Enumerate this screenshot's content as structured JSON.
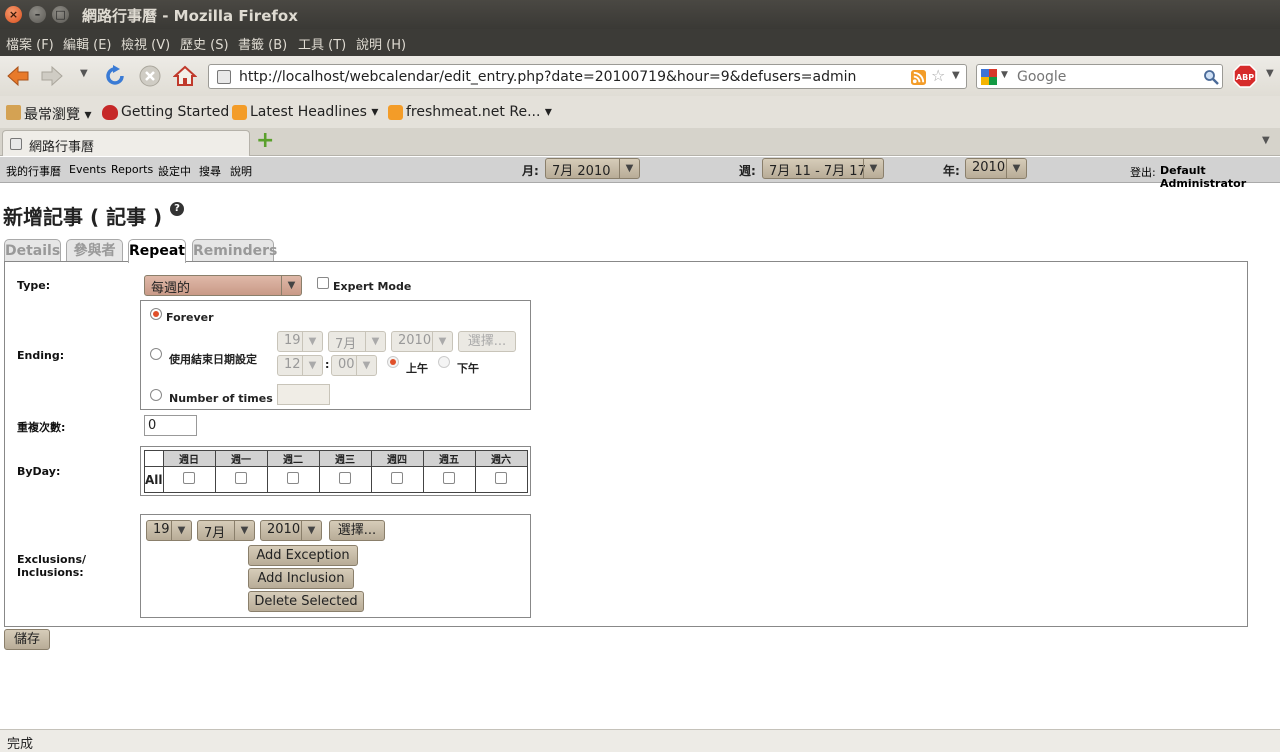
{
  "window": {
    "title": "網路行事曆 - Mozilla Firefox"
  },
  "menubar": [
    "檔案 (F)",
    "編輯 (E)",
    "檢視 (V)",
    "歷史 (S)",
    "書籤 (B)",
    "工具 (T)",
    "說明 (H)"
  ],
  "navbar": {
    "url": "http://localhost/webcalendar/edit_entry.php?date=20100719&hour=9&defusers=admin",
    "search_placeholder": "Google"
  },
  "bookmarks": [
    {
      "label": "最常瀏覽 ▾"
    },
    {
      "label": "Getting Started"
    },
    {
      "label": "Latest Headlines ▾"
    },
    {
      "label": "freshmeat.net Re... ▾"
    }
  ],
  "browser_tab": {
    "label": "網路行事曆",
    "new_tab": "+"
  },
  "topnav": {
    "links": [
      "我的行事曆",
      "Events",
      "Reports",
      "設定中",
      "搜尋",
      "說明"
    ],
    "month_label": "月:",
    "month_value": "7月 2010",
    "week_label": "週:",
    "week_value": "7月 11 - 7月 17",
    "year_label": "年:",
    "year_value": "2010",
    "logout_label": "登出:",
    "user": "Default Administrator"
  },
  "page": {
    "heading": "新增記事 ( 記事 )",
    "tabs": [
      "Details",
      "參與者",
      "Repeat",
      "Reminders"
    ],
    "active_tab": "Repeat"
  },
  "repeat": {
    "type_label": "Type:",
    "type_value": "每週的",
    "expert_mode": "Expert Mode",
    "ending_label": "Ending:",
    "forever": "Forever",
    "use_end_date": "使用結束日期設定",
    "end_day": "19",
    "end_month": "7月",
    "end_year": "2010",
    "choose": "選擇...",
    "end_hour": "12",
    "end_min": "00",
    "colon": ":",
    "am": "上午",
    "pm": "下午",
    "number_of_times": "Number of times",
    "repeat_count_label": "重複次數:",
    "repeat_count_value": "0",
    "byday_label": "ByDay:",
    "byday_days": [
      "週日",
      "週一",
      "週二",
      "週三",
      "週四",
      "週五",
      "週六"
    ],
    "byday_all": "All",
    "exclusions_label_1": "Exclusions/",
    "exclusions_label_2": "Inclusions:",
    "ex_day": "19",
    "ex_month": "7月",
    "ex_year": "2010",
    "ex_choose": "選擇...",
    "add_exception": "Add Exception",
    "add_inclusion": "Add Inclusion",
    "delete_selected": "Delete Selected"
  },
  "save_button": "儲存",
  "status": "完成"
}
